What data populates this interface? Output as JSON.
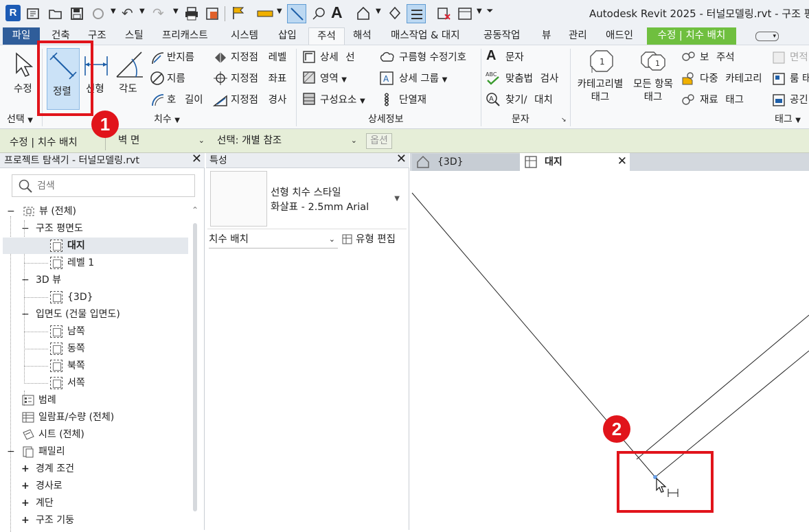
{
  "window": {
    "title": "Autodesk Revit 2025 - 터널모델링.rvt - 구조 평"
  },
  "tabs": [
    {
      "label": "파일"
    },
    {
      "label": "건축"
    },
    {
      "label": "구조"
    },
    {
      "label": "스틸"
    },
    {
      "label": "프리캐스트"
    },
    {
      "label": "시스템"
    },
    {
      "label": "삽입"
    },
    {
      "label": "주석"
    },
    {
      "label": "해석"
    },
    {
      "label": "매스작업 & 대지"
    },
    {
      "label": "공동작업"
    },
    {
      "label": "뷰"
    },
    {
      "label": "관리"
    },
    {
      "label": "애드인"
    },
    {
      "label": "수정 | 치수 배치"
    }
  ],
  "ribbon": {
    "select": {
      "modify": "수정",
      "title": "선택"
    },
    "dimension": {
      "aligned": "정렬",
      "linear": "선형",
      "angular": "각도",
      "radial": "반지름",
      "diameter": "지름",
      "arc_length": "호 길이",
      "spot_elevation": "지정점 레벨",
      "spot_coordinate": "지정점 좌표",
      "spot_slope": "지정점 경사",
      "title": "치수"
    },
    "detail": {
      "detail_line": "상세 선",
      "region": "영역",
      "component": "구성요소",
      "revision_cloud": "구름형 수정기호",
      "detail_group": "상세 그룹",
      "insulation": "단열재",
      "title": "상세정보"
    },
    "text": {
      "text": "문자",
      "spelling": "맞춤법 검사",
      "find_replace": "찾기/ 대치",
      "title": "문자"
    },
    "tag": {
      "by_category": "카테고리별 태그",
      "all": "모든 항목 태그",
      "beam_annotation": "보 주석",
      "multi_category": "다중 카테고리",
      "material_tag": "재료 태그",
      "area": "면적",
      "room": "룸 태",
      "space": "공긴",
      "title": "태그"
    }
  },
  "options_bar": {
    "context": "수정 | 치수 배치",
    "reference": "벽 면",
    "pick": "선택: 개별 참조",
    "options": "옵션"
  },
  "project_browser": {
    "title": "프로젝트 탐색기 - 터널모델링.rvt",
    "search_placeholder": "검색",
    "items": [
      {
        "label": "뷰 (전체)"
      },
      {
        "label": "구조 평면도"
      },
      {
        "label": "대지"
      },
      {
        "label": "레벨 1"
      },
      {
        "label": "3D 뷰"
      },
      {
        "label": "{3D}"
      },
      {
        "label": "입면도 (건물 입면도)"
      },
      {
        "label": "남쪽"
      },
      {
        "label": "동쪽"
      },
      {
        "label": "북쪽"
      },
      {
        "label": "서쪽"
      },
      {
        "label": "범례"
      },
      {
        "label": "일람표/수량 (전체)"
      },
      {
        "label": "시트 (전체)"
      },
      {
        "label": "패밀리"
      },
      {
        "label": "경계 조건"
      },
      {
        "label": "경사로"
      },
      {
        "label": "계단"
      },
      {
        "label": "구조 기둥"
      }
    ]
  },
  "properties": {
    "title": "특성",
    "type_line1": "선형 치수 스타일",
    "type_line2": "화살표 - 2.5mm Arial",
    "filter": "치수 배치",
    "edit_type": "유형 편집"
  },
  "view_tabs": [
    {
      "label": "{3D}"
    },
    {
      "label": "대지"
    }
  ],
  "callouts": {
    "one": "1",
    "two": "2"
  },
  "colors": {
    "accent_tab": "#2f5d9a",
    "contextual_tab": "#6fbf3f",
    "callout": "#e1141b",
    "options_bar": "#e6eed8"
  }
}
